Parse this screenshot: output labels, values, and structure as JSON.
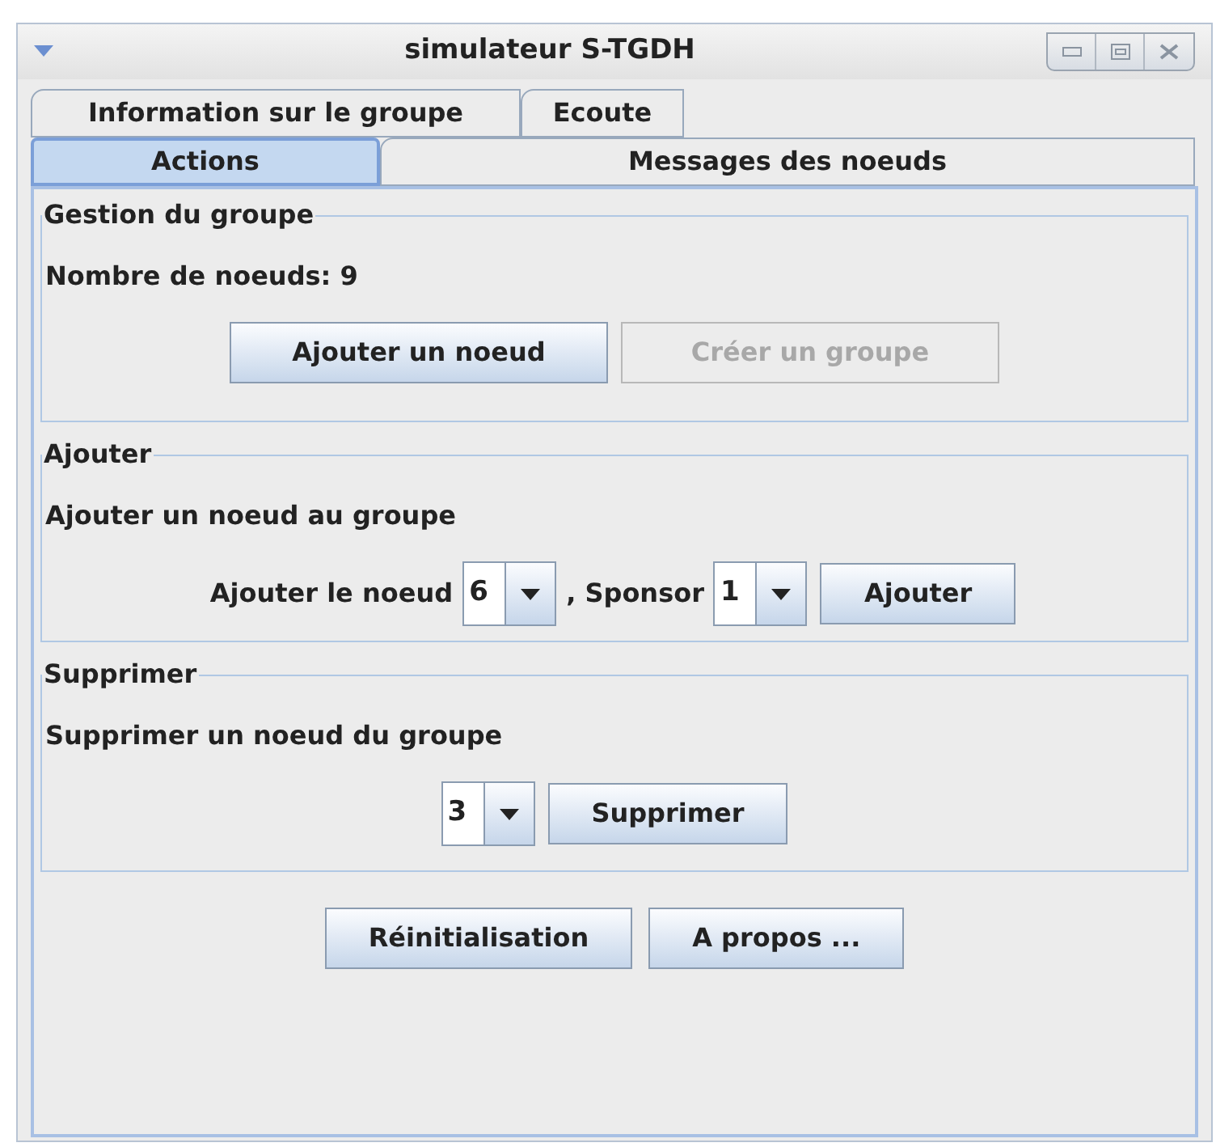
{
  "window": {
    "title": "simulateur S-TGDH"
  },
  "tab_rows": [
    [
      {
        "label": "Information sur le groupe",
        "selected": false
      },
      {
        "label": "Ecoute",
        "selected": false
      }
    ],
    [
      {
        "label": "Actions",
        "selected": true
      },
      {
        "label": "Messages des noeuds",
        "selected": false
      }
    ]
  ],
  "sections": [
    {
      "title": "Gestion du groupe",
      "text": "Nombre de noeuds: 9",
      "controls": [
        {
          "kind": "button",
          "label": "Ajouter un noeud",
          "disabled": false
        },
        {
          "kind": "button",
          "label": "Créer un groupe",
          "disabled": true
        }
      ]
    },
    {
      "title": "Ajouter",
      "text": "Ajouter un noeud au groupe",
      "controls": [
        {
          "kind": "label",
          "label": "Ajouter le noeud"
        },
        {
          "kind": "combo",
          "value": "6"
        },
        {
          "kind": "label",
          "label": ", Sponsor"
        },
        {
          "kind": "combo",
          "value": "1"
        },
        {
          "kind": "button",
          "label": "Ajouter",
          "disabled": false
        }
      ]
    },
    {
      "title": "Supprimer",
      "text": "Supprimer un noeud du groupe",
      "controls": [
        {
          "kind": "combo",
          "value": "3"
        },
        {
          "kind": "button",
          "label": "Supprimer",
          "disabled": false
        }
      ]
    }
  ],
  "bottom_buttons": [
    {
      "label": "Réinitialisation"
    },
    {
      "label": "A propos ..."
    }
  ]
}
